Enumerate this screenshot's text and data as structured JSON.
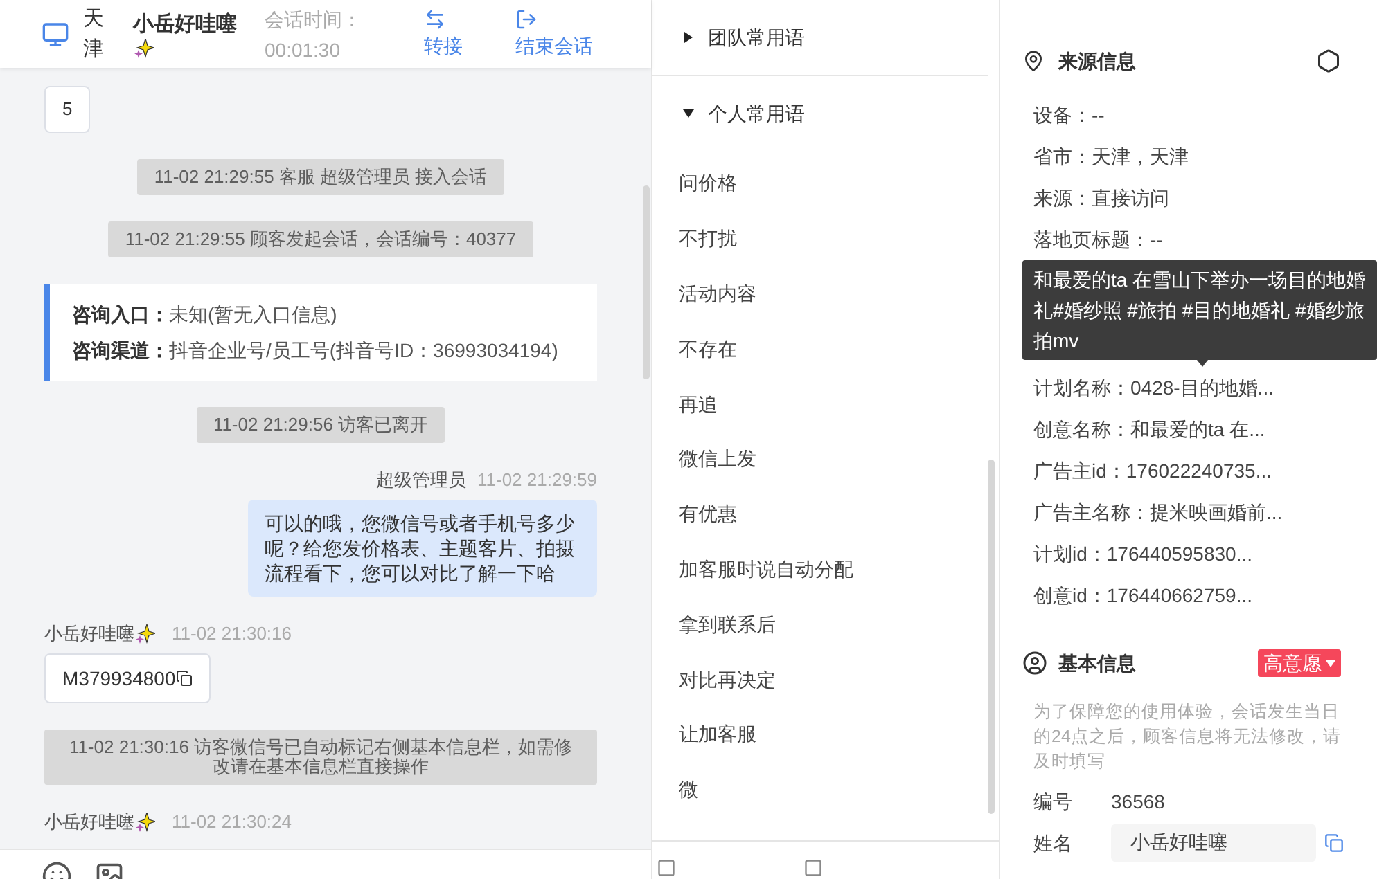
{
  "chat_header": {
    "city": "天津",
    "visitor_name": "小岳好哇噻",
    "session_time_label": "会话时间：",
    "session_time": "00:01:30",
    "actions": [
      {
        "label": "转接",
        "kind": "transfer"
      },
      {
        "label": "结束会话",
        "kind": "end"
      }
    ]
  },
  "messages": [
    {
      "kind": "bubble",
      "text": "5"
    },
    {
      "kind": "system",
      "text": "11-02 21:29:55 客服 超级管理员 接入会话"
    },
    {
      "kind": "system",
      "text": "11-02 21:29:55 顾客发起会话，会话编号：40377"
    },
    {
      "kind": "entry_card",
      "lines": [
        {
          "label": "咨询入口：",
          "value": "未知(暂无入口信息)"
        },
        {
          "label": "咨询渠道：",
          "value": "抖音企业号/员工号(抖音号ID：36993034194)"
        }
      ]
    },
    {
      "kind": "system",
      "text": "11-02 21:29:56 访客已离开"
    },
    {
      "kind": "outgoing",
      "sender": "超级管理员",
      "time": "11-02 21:29:59",
      "text": "可以的哦，您微信号或者手机号多少呢？给您发价格表、主题客片、拍摄流程看下，您可以对比了解一下哈"
    },
    {
      "kind": "incoming",
      "sender": "小岳好哇噻",
      "time": "11-02 21:30:16",
      "text": "M379934800"
    },
    {
      "kind": "system",
      "text": "11-02 21:30:16 访客微信号已自动标记右侧基本信息栏，如需修改请在基本信息栏直接操作"
    },
    {
      "kind": "incoming_header",
      "sender": "小岳好哇噻",
      "time": "11-02 21:30:24"
    }
  ],
  "quick_phrases": {
    "groups": [
      {
        "title": "团队常用语",
        "expanded": false
      },
      {
        "title": "个人常用语",
        "expanded": true,
        "items": [
          "问价格",
          "不打扰",
          "活动内容",
          "不存在",
          "再追",
          "微信上发",
          "有优惠",
          "加客服时说自动分配",
          "拿到联系后",
          "对比再决定",
          "让加客服",
          "微"
        ]
      }
    ]
  },
  "source_info": {
    "title": "来源信息",
    "fields_before": [
      "设备：--",
      "省市：天津，天津",
      "来源：直接访问",
      "落地页标题：--"
    ],
    "tooltip": "和最爱的ta 在雪山下举办一场目的地婚礼#婚纱照 #旅拍 #目的地婚礼 #婚纱旅拍mv",
    "fields_after": [
      "计划名称：0428-目的地婚...",
      "创意名称：和最爱的ta 在...",
      "广告主id：176022240735...",
      "广告主名称：提米映画婚前...",
      "计划id：176440595830...",
      "创意id：176440662759..."
    ]
  },
  "basic_info": {
    "title": "基本信息",
    "intent_tag": "高意愿",
    "notice": "为了保障您的使用体验，会话发生当日的24点之后，顾客信息将无法修改，请及时填写",
    "fields": [
      {
        "label": "编号",
        "value": "36568",
        "kind": "text"
      },
      {
        "label": "姓名",
        "value": "小岳好哇噻",
        "kind": "input"
      }
    ]
  }
}
